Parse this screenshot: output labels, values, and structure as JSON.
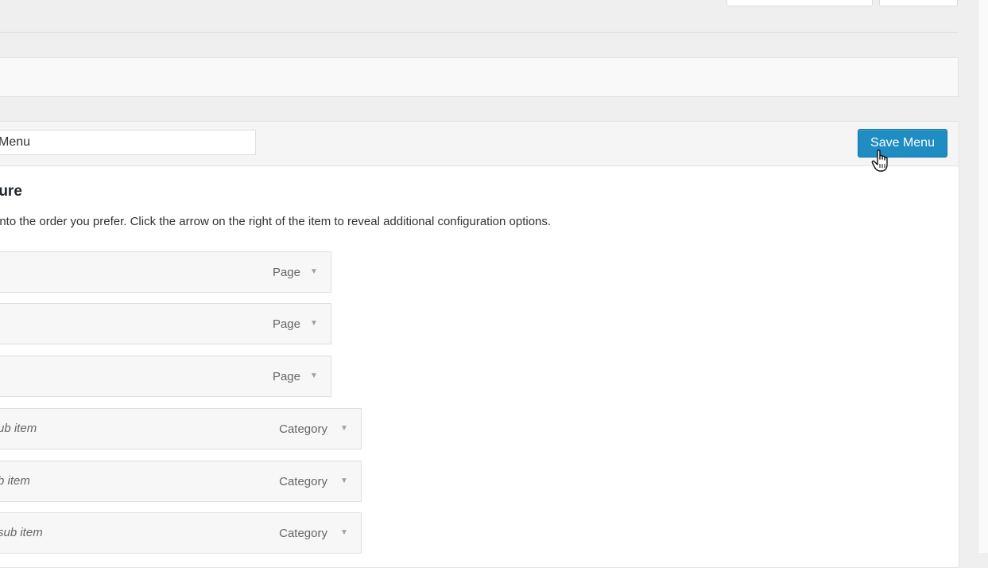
{
  "header": {
    "top_buttons": [
      "",
      ""
    ]
  },
  "menu": {
    "name_value": "Menu",
    "save_label": "Save Menu"
  },
  "structure": {
    "title": "ture",
    "description": "into the order you prefer. Click the arrow on the right of the item to reveal additional configuration options."
  },
  "items": [
    {
      "title": "",
      "type": "Page"
    },
    {
      "title": "",
      "type": "Page"
    },
    {
      "title": "",
      "type": "Page"
    },
    {
      "title": "ub item",
      "type": "Category"
    },
    {
      "title": "b item",
      "type": "Category"
    },
    {
      "title": "sub item",
      "type": "Category"
    }
  ],
  "icons": {
    "arrow": "triangle-down-icon",
    "cursor": "hand-pointer-icon"
  },
  "colors": {
    "primary_button": "#1f8dc2",
    "background": "#efefef",
    "panel": "#ffffff"
  }
}
